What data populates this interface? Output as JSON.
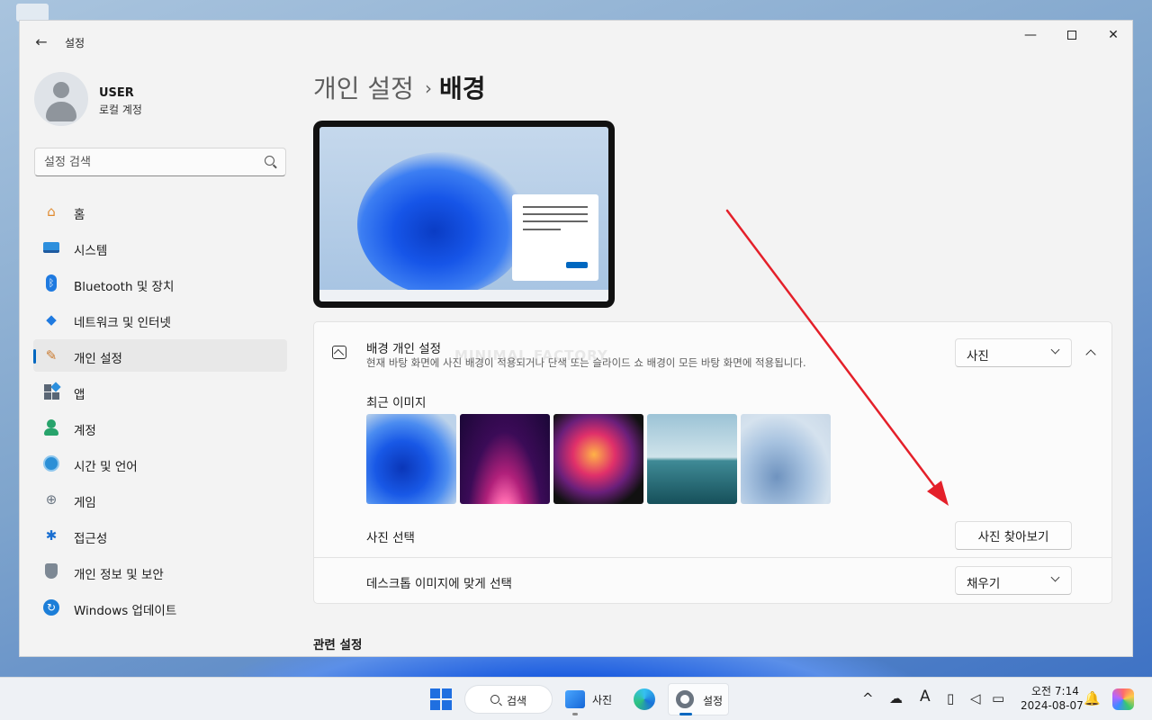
{
  "window": {
    "title": "설정",
    "back_icon": "←",
    "minimize_icon": "—",
    "close_icon": "✕"
  },
  "user": {
    "name": "USER",
    "account_type": "로컬 계정"
  },
  "search": {
    "placeholder": "설정 검색"
  },
  "sidebar": {
    "items": [
      {
        "label": "홈",
        "icon": "home-icon",
        "glyph": "⌂"
      },
      {
        "label": "시스템",
        "icon": "system-icon"
      },
      {
        "label": "Bluetooth 및 장치",
        "icon": "bluetooth-icon",
        "glyph": "ᛒ"
      },
      {
        "label": "네트워크 및 인터넷",
        "icon": "wifi-icon",
        "glyph": "◆"
      },
      {
        "label": "개인 설정",
        "icon": "brush-icon",
        "glyph": "✎",
        "active": true
      },
      {
        "label": "앱",
        "icon": "apps-icon"
      },
      {
        "label": "계정",
        "icon": "account-icon"
      },
      {
        "label": "시간 및 언어",
        "icon": "clock-globe-icon"
      },
      {
        "label": "게임",
        "icon": "gamepad-icon",
        "glyph": "⊕"
      },
      {
        "label": "접근성",
        "icon": "accessibility-icon",
        "glyph": "✱"
      },
      {
        "label": "개인 정보 및 보안",
        "icon": "shield-icon"
      },
      {
        "label": "Windows 업데이트",
        "icon": "update-icon",
        "glyph": "↻"
      }
    ]
  },
  "main": {
    "breadcrumb": {
      "parent": "개인 설정",
      "separator": "›",
      "current": "배경"
    },
    "background": {
      "title": "배경 개인 설정",
      "description": "현재 바탕 화면에 사진 배경이 적용되거나 단색 또는 슬라이드 쇼 배경이 모든 바탕 화면에 적용됩니다.",
      "dropdown_value": "사진",
      "watermark": "MINIMAL FACTORY"
    },
    "recent": {
      "title": "최근 이미지",
      "thumbnails": [
        "bloom-blue",
        "purple-glow",
        "colorful-ribbon",
        "lake-sunrise",
        "pale-bloom"
      ]
    },
    "choose_photo": {
      "label": "사진 선택",
      "button": "사진 찾아보기"
    },
    "fit": {
      "label": "데스크톱 이미지에 맞게 선택",
      "dropdown_value": "채우기"
    },
    "related_title": "관련 설정"
  },
  "annotation": {
    "color": "#e4202a"
  },
  "taskbar": {
    "search_label": "검색",
    "photos_label": "사진",
    "settings_label": "설정",
    "clock_time": "오전 7:14",
    "clock_date": "2024-08-07",
    "tray_chevron": "^",
    "tray_font": "A",
    "bell_glyph": "🔔"
  },
  "colors": {
    "accent": "#0067c0",
    "window_bg": "#f3f3f3",
    "card_bg": "#fbfbfb"
  }
}
